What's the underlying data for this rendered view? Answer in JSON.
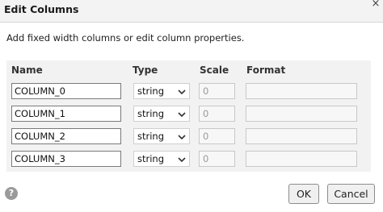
{
  "dialog": {
    "title": "Edit Columns",
    "close_glyph": "×",
    "instruction": "Add fixed width columns or edit column properties."
  },
  "table": {
    "headers": {
      "name": "Name",
      "type": "Type",
      "scale": "Scale",
      "format": "Format"
    },
    "rows": [
      {
        "name": "COLUMN_0",
        "type": "string",
        "scale": "0",
        "format": ""
      },
      {
        "name": "COLUMN_1",
        "type": "string",
        "scale": "0",
        "format": ""
      },
      {
        "name": "COLUMN_2",
        "type": "string",
        "scale": "0",
        "format": ""
      },
      {
        "name": "COLUMN_3",
        "type": "string",
        "scale": "0",
        "format": ""
      }
    ]
  },
  "footer": {
    "help_glyph": "?",
    "ok_label": "OK",
    "cancel_label": "Cancel"
  }
}
